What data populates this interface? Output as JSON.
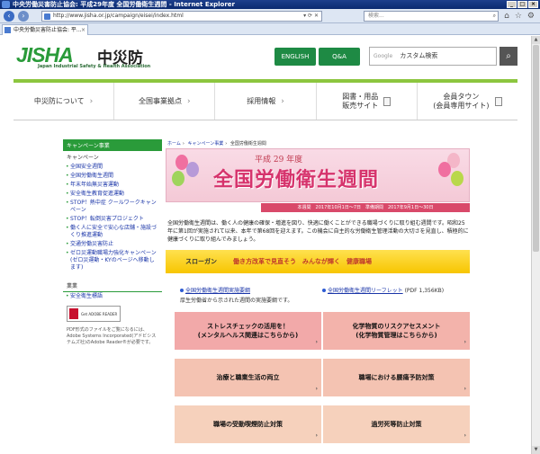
{
  "window": {
    "title": "中央労働災害防止協会: 平成29年度 全国労働衛生週間 - Internet Explorer",
    "url": "http://www.jisha.or.jp/campaign/eisei/index.html",
    "search_placeholder": "検索...",
    "tab_label": "中央労働災害防止協会: 平..."
  },
  "header": {
    "logo_text": "JISHA",
    "logo_kanji": "中災防",
    "logo_sub": "Japan Industrial Safety & Health Association",
    "english_btn": "ENGLISH",
    "qa_btn": "Q&A",
    "search_google": "Google",
    "search_value": "カスタム検索"
  },
  "gnav": [
    {
      "label": "中災防について"
    },
    {
      "label": "全国事業拠点"
    },
    {
      "label": "採用情報"
    },
    {
      "label": "図書・用品\n販売サイト"
    },
    {
      "label": "会員タウン\n(会員専用サイト)"
    }
  ],
  "sidebar": {
    "header": "キャンペーン事業",
    "subheader": "キャンペーン",
    "items": [
      "全国安全週間",
      "全国労働衛生週間",
      "年末年始無災害運動",
      "安全衛生教育促進運動",
      "STOP！熱中症 クールワークキャンペーン",
      "STOP！転倒災害プロジェクト",
      "働く人に安全で安心な店舗・施設づくり推進運動",
      "交通労働災害防止",
      "ゼロ災運動職場力強化キャンペーン(ゼロ災運動・KYのページへ移動します)"
    ],
    "section2_header": "業業",
    "section2_items": [
      "安全衛生標語"
    ]
  },
  "pdf": {
    "badge": "Get ADOBE READER",
    "note": "PDF形式のファイルをご覧になるには、Adobe Systems Incorporated(アドビシステムズ社)のAdobe Reader®が必要です。"
  },
  "breadcrumb": [
    "ホーム",
    "キャンペーン事業",
    "全国労働衛生週間"
  ],
  "banner": {
    "year": "平成 29 年度",
    "title": "全国労働衛生週間",
    "dates": "本週間　2017年10月1日〜7日　準備期間　2017年9月1日〜30日"
  },
  "intro": "全国労働衛生週間は、働く人の健康の確保・増進を図り、快適に働くことができる職場づくりに取り組む週間です。昭和25年に第1回が実施されて以来、本年で第68回を迎えます。この機会に自主的な労働衛生管理活動の大切さを見直し、積極的に健康づくりに取り組んでみましょう。",
  "slogan": {
    "label": "スローガン",
    "text": "働き方改革で見直そう　みんなが輝く　健康職場"
  },
  "links": [
    {
      "title": "全国労働衛生週間実施要綱",
      "desc": "厚生労働省から示された週間の実施要綱です。"
    },
    {
      "title": "全国労働衛生週間リーフレット",
      "desc": "(PDF 1,356KB)"
    }
  ],
  "tiles": [
    {
      "label": "ストレスチェックの活用を！\n(メンタルヘルス関連はこちらから)",
      "color": "#f2a9a9"
    },
    {
      "label": "化学物質のリスクアセスメント\n(化学物質管理はこちらから)",
      "color": "#f3b3ab"
    },
    {
      "label": "治療と職業生活の両立",
      "color": "#f4c3b2"
    },
    {
      "label": "職場における腰痛予防対策",
      "color": "#f4c3b2"
    },
    {
      "label": "職場の受動喫煙防止対策",
      "color": "#f6d1bc"
    },
    {
      "label": "過労死等防止対策",
      "color": "#f6d1bc"
    }
  ]
}
